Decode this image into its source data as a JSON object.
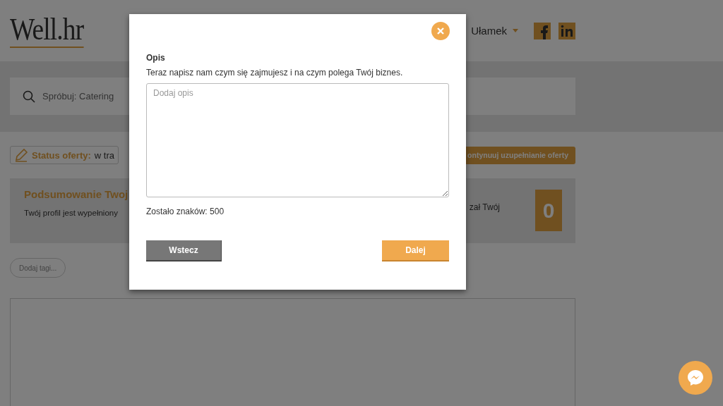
{
  "header": {
    "logo": "Well.hr",
    "user_menu": "Ułamek"
  },
  "search": {
    "placeholder": "Spróbuj: Catering"
  },
  "status": {
    "label": "Status oferty:",
    "value": "w tra",
    "button": "ontynuuj uzupełnianie oferty"
  },
  "summary": {
    "title": "Podsumowanie Twoj",
    "text": "Twój profil jest wypełniony",
    "text_right": "zał Twój",
    "count": "0"
  },
  "tags_button": "Dodaj tagi...",
  "modal": {
    "title": "Opis",
    "description": "Teraz napisz nam czym się zajmujesz i na czym polega Twój biznes.",
    "textarea": {
      "placeholder": "Dodaj opis"
    },
    "counter": "Zostało znaków: 500",
    "back_button": "Wstecz",
    "next_button": "Dalej"
  }
}
